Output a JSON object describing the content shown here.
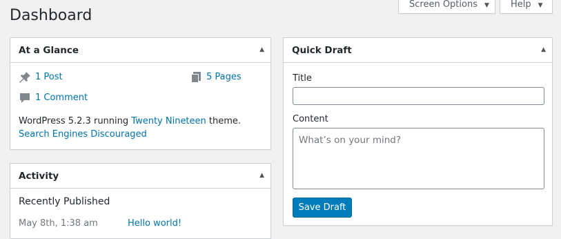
{
  "page": {
    "title": "Dashboard"
  },
  "tabs": {
    "screen_options": "Screen Options",
    "help": "Help"
  },
  "glance": {
    "title": "At a Glance",
    "posts": "1 Post",
    "pages": "5 Pages",
    "comments": "1 Comment",
    "wp_prefix": "WordPress 5.2.3 running ",
    "theme": "Twenty Nineteen",
    "wp_suffix": " theme.",
    "search_engines": "Search Engines Discouraged"
  },
  "activity": {
    "title": "Activity",
    "recently_published": "Recently Published",
    "items": [
      {
        "date": "May 8th, 1:38 am",
        "title": "Hello world!"
      }
    ]
  },
  "quick_draft": {
    "title": "Quick Draft",
    "title_label": "Title",
    "title_value": "",
    "content_label": "Content",
    "content_placeholder": "What’s on your mind?",
    "save_label": "Save Draft"
  },
  "colors": {
    "link": "#0073aa",
    "primary_button": "#007cba",
    "background": "#f1f1f1"
  },
  "icons": [
    "pin-icon",
    "pages-icon",
    "comment-icon",
    "toggle-arrow-icon",
    "dropdown-arrow-icon"
  ]
}
